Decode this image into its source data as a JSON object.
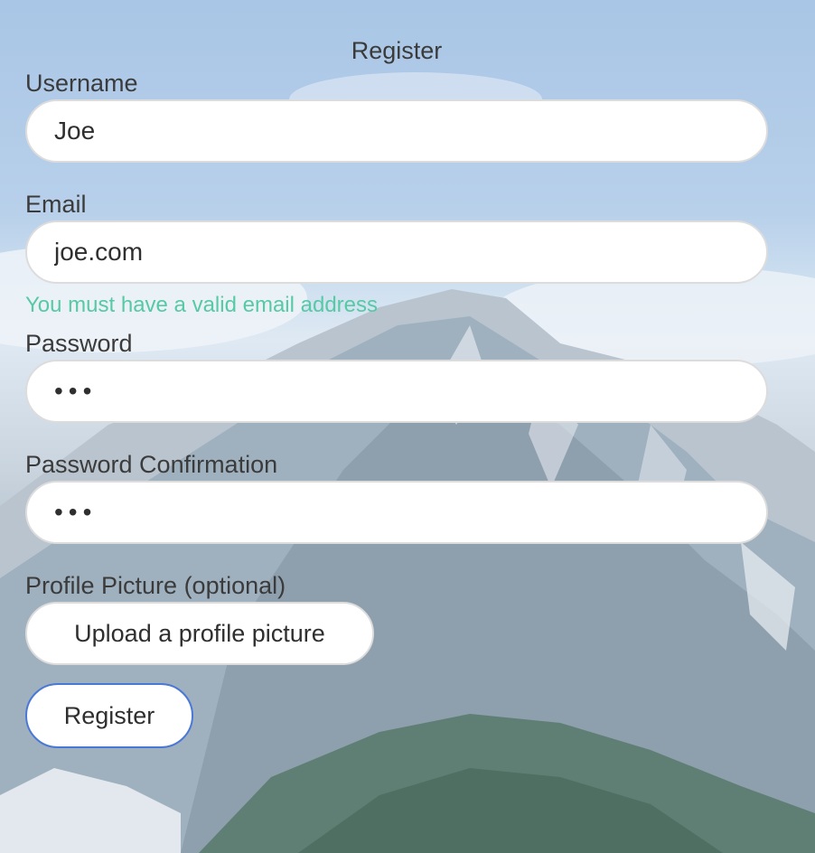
{
  "form": {
    "title": "Register",
    "username": {
      "label": "Username",
      "value": "Joe"
    },
    "email": {
      "label": "Email",
      "value": "joe.com",
      "error": "You must have a valid email address"
    },
    "password": {
      "label": "Password",
      "value": "abc"
    },
    "password_confirmation": {
      "label": "Password Confirmation",
      "value": "abc"
    },
    "profile_picture": {
      "label": "Profile Picture (optional)",
      "button_label": "Upload a profile picture"
    },
    "submit_label": "Register"
  },
  "colors": {
    "error_text": "#56c9a5",
    "focus_border": "#4a78d6",
    "field_border": "#dcdcdc"
  }
}
